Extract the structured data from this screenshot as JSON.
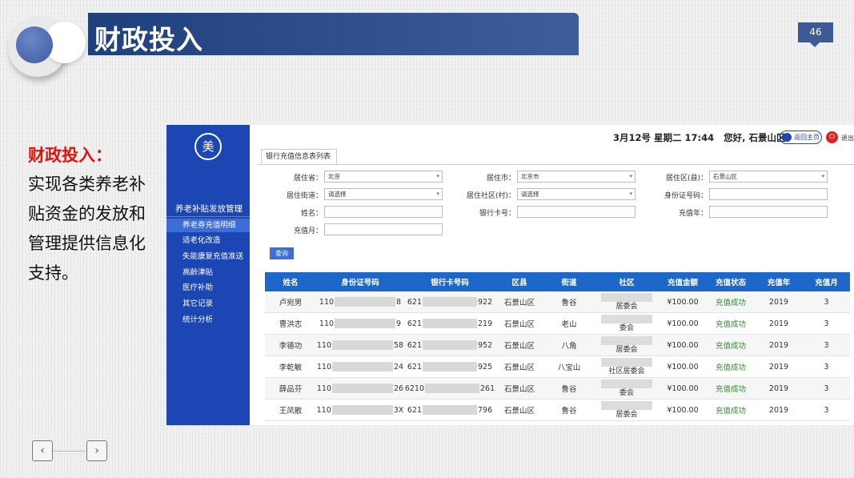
{
  "slide": {
    "title": "财政投入",
    "page_number": "46"
  },
  "side_text": {
    "heading": "财政投入：",
    "body": "实现各类养老补贴资金的发放和管理提供信息化支持。"
  },
  "nav": {
    "prev": "‹",
    "next": "›"
  },
  "app": {
    "logo": "美",
    "sidebar": {
      "section": "养老补贴发放管理",
      "items": [
        "养老券充值明细",
        "适老化改造",
        "失能康复充值准送",
        "高龄津贴",
        "医疗补助",
        "其它记录",
        "统计分析"
      ]
    },
    "topbar": {
      "datetime": "3月12号 星期二 17:44",
      "greeting": "您好, 石景山区",
      "home_button": "返回主页",
      "exit": "退出"
    },
    "tab": "银行充值信息表列表",
    "filters": {
      "province_label": "居住省：",
      "province_value": "北京",
      "city_label": "居住市：",
      "city_value": "北京市",
      "district_label": "居住区(县)：",
      "district_value": "石景山区",
      "street_label": "居住街道：",
      "street_value": "请选择",
      "community_label": "居住社区(村)：",
      "community_value": "请选择",
      "id_label": "身份证号码：",
      "name_label": "姓名：",
      "card_label": "银行卡号：",
      "year_label": "充值年：",
      "month_label": "充值月：",
      "query_button": "查询"
    },
    "table": {
      "headers": [
        "姓名",
        "身份证号码",
        "银行卡号码",
        "区县",
        "街道",
        "社区",
        "充值金额",
        "充值状态",
        "充值年",
        "充值月"
      ],
      "rows": [
        {
          "name": "卢宛男",
          "id_a": "110",
          "id_b": "8",
          "card_a": "621",
          "card_b": "922",
          "district": "石景山区",
          "street": "鲁谷",
          "community": "居委会",
          "amount": "¥100.00",
          "status": "充值成功",
          "year": "2019",
          "month": "3"
        },
        {
          "name": "曹洪志",
          "id_a": "110",
          "id_b": "9",
          "card_a": "621",
          "card_b": "219",
          "district": "石景山区",
          "street": "老山",
          "community": "委会",
          "amount": "¥100.00",
          "status": "充值成功",
          "year": "2019",
          "month": "3"
        },
        {
          "name": "李德功",
          "id_a": "110",
          "id_b": "58",
          "card_a": "621",
          "card_b": "952",
          "district": "石景山区",
          "street": "八角",
          "community": "居委会",
          "amount": "¥100.00",
          "status": "充值成功",
          "year": "2019",
          "month": "3"
        },
        {
          "name": "李乾敏",
          "id_a": "110",
          "id_b": "24",
          "card_a": "621",
          "card_b": "925",
          "district": "石景山区",
          "street": "八宝山",
          "community": "社区居委会",
          "amount": "¥100.00",
          "status": "充值成功",
          "year": "2019",
          "month": "3"
        },
        {
          "name": "薛品芬",
          "id_a": "110",
          "id_b": "26",
          "card_a": "6210",
          "card_b": "261",
          "district": "石景山区",
          "street": "鲁谷",
          "community": "委会",
          "amount": "¥100.00",
          "status": "充值成功",
          "year": "2019",
          "month": "3"
        },
        {
          "name": "王凤散",
          "id_a": "110",
          "id_b": "3X",
          "card_a": "621",
          "card_b": "796",
          "district": "石景山区",
          "street": "鲁谷",
          "community": "居委会",
          "amount": "¥100.00",
          "status": "充值成功",
          "year": "2019",
          "month": "3"
        }
      ]
    }
  },
  "colors": {
    "title_bar": "#2a4a8a",
    "sidebar": "#1b46b4",
    "table_header": "#1c67c9",
    "accent_red": "#e0140d",
    "status_ok": "#2d8c2d"
  }
}
